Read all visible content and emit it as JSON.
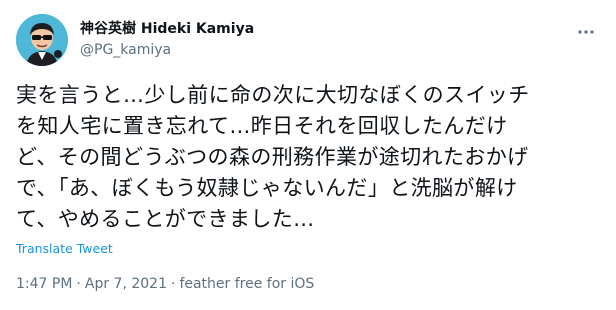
{
  "author": {
    "display_name": "神谷英樹 Hideki Kamiya",
    "handle": "@PG_kamiya",
    "avatar_icon": "cartoon-avatar-icon",
    "avatar_bg": "#4fb8d8"
  },
  "more_icon": "more-dots-icon",
  "tweet": {
    "text": "実を言うと…少し前に命の次に大切なぼくのスイッチ\nを知人宅に置き忘れて…昨日それを回収したんだけ\nど、その間どうぶつの森の刑務作業が途切れたおかげ\nで、「あ、ぼくもう奴隷じゃないんだ」と洗脳が解け\nて、やめることができました…",
    "translate_label": "Translate Tweet"
  },
  "meta": {
    "time": "1:47 PM",
    "date": "Apr 7, 2021",
    "source": "feather free for iOS",
    "separator": "·"
  },
  "colors": {
    "link": "#1b95e0",
    "secondary_text": "#5b7083",
    "primary_text": "#0f1419"
  }
}
